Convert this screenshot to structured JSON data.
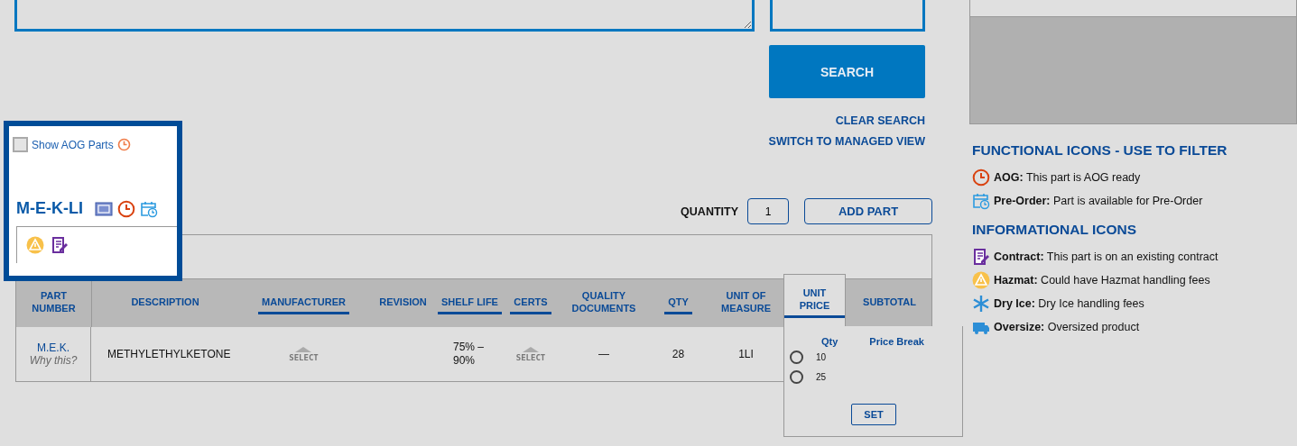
{
  "search": {
    "button": "SEARCH",
    "clear": "CLEAR SEARCH",
    "switch_view": "SWITCH TO MANAGED VIEW"
  },
  "quantity": {
    "label": "QUANTITY",
    "value": "1"
  },
  "add_part": "ADD PART",
  "aog_filter": {
    "label": "Show AOG Parts",
    "checked": false
  },
  "part": {
    "title": "M-E-K-LI",
    "icons": [
      {
        "kind": "certificate"
      },
      {
        "kind": "aog"
      },
      {
        "kind": "preorder"
      }
    ],
    "info_icons": [
      {
        "kind": "hazmat"
      },
      {
        "kind": "contract"
      }
    ]
  },
  "table": {
    "columns": [
      {
        "label": "PART NUMBER",
        "sortable": false
      },
      {
        "label": "DESCRIPTION",
        "sortable": false
      },
      {
        "label": "MANUFACTURER",
        "sortable": true
      },
      {
        "label": "REVISION",
        "sortable": false
      },
      {
        "label": "SHELF LIFE",
        "sortable": true
      },
      {
        "label": "CERTS",
        "sortable": true
      },
      {
        "label": "QUALITY DOCUMENTS",
        "sortable": false
      },
      {
        "label": "QTY",
        "sortable": true
      },
      {
        "label": "UNIT OF MEASURE",
        "sortable": false
      },
      {
        "label": "UNIT PRICE",
        "sortable": true
      },
      {
        "label": "SUBTOTAL",
        "sortable": false
      }
    ],
    "rows": [
      {
        "part_number": "M.E.K.",
        "why": "Why this?",
        "description": "METHYLETHYLKETONE",
        "manufacturer": "SELECT",
        "shelf_life": "75% – 90%",
        "certs": "SELECT",
        "quality_documents": "—",
        "qty": "28",
        "unit_of_measure": "1LI"
      }
    ]
  },
  "price_popover": {
    "columns": [
      "Qty",
      "Price Break"
    ],
    "options": [
      {
        "qty": "10",
        "selected": false
      },
      {
        "qty": "25",
        "selected": false
      }
    ],
    "button": "SET"
  },
  "legend": [
    {
      "title": "FUNCTIONAL ICONS - USE TO FILTER",
      "items": [
        {
          "kind": "aog",
          "label": "AOG:",
          "text": "This part is AOG ready"
        },
        {
          "kind": "preorder",
          "label": "Pre-Order:",
          "text": "Part is available for Pre-Order"
        }
      ]
    },
    {
      "title": "INFORMATIONAL ICONS",
      "items": [
        {
          "kind": "contract",
          "label": "Contract:",
          "text": "This part is on an existing contract"
        },
        {
          "kind": "hazmat",
          "label": "Hazmat:",
          "text": "Could have Hazmat handling fees"
        },
        {
          "kind": "dryice",
          "label": "Dry Ice:",
          "text": "Dry Ice handling fees"
        },
        {
          "kind": "oversize",
          "label": "Oversize:",
          "text": "Oversized product"
        }
      ]
    }
  ]
}
